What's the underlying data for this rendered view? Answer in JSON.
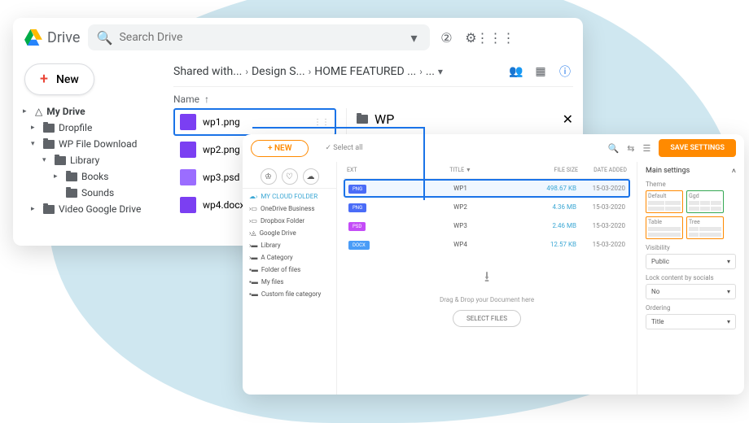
{
  "drive": {
    "brand": "Drive",
    "search_placeholder": "Search Drive",
    "new_label": "New",
    "tree": {
      "root": "My Drive",
      "n1": "Dropfile",
      "n2": "WP File Download",
      "n3": "Library",
      "n4": "Books",
      "n5": "Sounds",
      "n6": "Video Google Drive"
    },
    "breadcrumb": {
      "b1": "Shared with...",
      "b2": "Design S...",
      "b3": "HOME FEATURED ...",
      "b4": "..."
    },
    "col_name": "Name",
    "files": {
      "f1": "wp1.png",
      "f2": "wp2.png",
      "f3": "wp3.psd",
      "f4": "wp4.docx"
    },
    "detail_title": "WP"
  },
  "wp": {
    "new_label": "+ NEW",
    "select_all": "✓ Select all",
    "save": "SAVE SETTINGS",
    "side": {
      "s1": "MY CLOUD FOLDER",
      "s2": "OneDrive Business",
      "s3": "Dropbox Folder",
      "s4": "Google Drive",
      "s5": "Library",
      "s6": "A Category",
      "s7": "Folder of files",
      "s8": "My files",
      "s9": "Custom file category"
    },
    "cols": {
      "c1": "EXT",
      "c2": "TITLE ▼",
      "c3": "FILE SIZE",
      "c4": "DATE ADDED"
    },
    "rows": [
      {
        "ext": "PNG",
        "cls": "b-png",
        "title": "WP1",
        "size": "498.67 KB",
        "date": "15-03-2020"
      },
      {
        "ext": "PNG",
        "cls": "b-png",
        "title": "WP2",
        "size": "4.36 MB",
        "date": "15-03-2020"
      },
      {
        "ext": "PSD",
        "cls": "b-psd",
        "title": "WP3",
        "size": "2.46 MB",
        "date": "15-03-2020"
      },
      {
        "ext": "DOCX",
        "cls": "b-docx",
        "title": "WP4",
        "size": "12.57 KB",
        "date": "15-03-2020"
      }
    ],
    "drop_text": "Drag & Drop your Document here",
    "select_files": "SELECT FILES",
    "settings": {
      "heading": "Main settings",
      "theme": "Theme",
      "t1": "Default",
      "t2": "Ggd",
      "t3": "Table",
      "t4": "Tree",
      "visibility": "Visibility",
      "vis_val": "Public",
      "lock": "Lock content by socials",
      "lock_val": "No",
      "ordering": "Ordering",
      "ord_val": "Title"
    }
  }
}
